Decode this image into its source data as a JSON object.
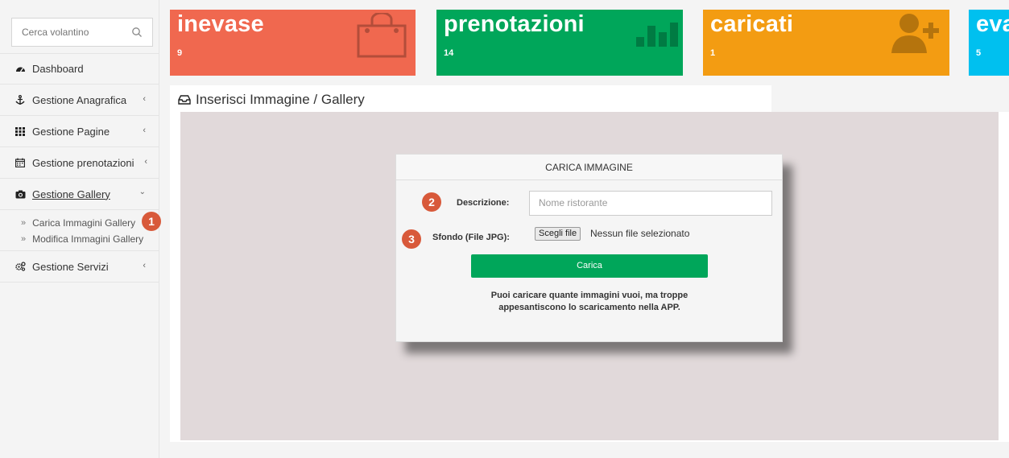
{
  "search": {
    "placeholder": "Cerca volantino"
  },
  "sidebar": {
    "items": [
      {
        "label": "Dashboard",
        "icon": "dashboard-icon"
      },
      {
        "label": "Gestione Anagrafica",
        "icon": "anchor-icon"
      },
      {
        "label": "Gestione Pagine",
        "icon": "grid-icon"
      },
      {
        "label": "Gestione prenotazioni",
        "icon": "calendar-icon"
      },
      {
        "label": "Gestione Gallery",
        "icon": "camera-icon"
      },
      {
        "label": "Gestione Servizi",
        "icon": "gears-icon"
      }
    ],
    "gallery_sub": [
      {
        "label": "Carica Immagini Gallery"
      },
      {
        "label": "Modifica Immagini Gallery"
      }
    ]
  },
  "markers": [
    "1",
    "2",
    "3"
  ],
  "tiles": [
    {
      "title": "inevase",
      "count": "9",
      "color": "#f0684f",
      "icon": "shopping-bag-icon"
    },
    {
      "title": "prenotazioni",
      "count": "14",
      "color": "#00a65a",
      "icon": "bar-chart-icon"
    },
    {
      "title": "caricati",
      "count": "1",
      "color": "#f39c12",
      "icon": "user-add-icon"
    },
    {
      "title": "eva",
      "count": "5",
      "color": "#00c0ef",
      "icon": ""
    }
  ],
  "panel": {
    "title": "Inserisci Immagine / Gallery"
  },
  "dialog": {
    "title": "CARICA IMMAGINE",
    "desc_label": "Descrizione:",
    "desc_placeholder": "Nome ristorante",
    "file_label": "Sfondo (File JPG):",
    "file_button": "Scegli file",
    "file_status": "Nessun file selezionato",
    "submit": "Carica",
    "note_line1": "Puoi caricare quante immagini vuoi, ma troppe",
    "note_line2": "appesantiscono lo scaricamento nella APP."
  }
}
